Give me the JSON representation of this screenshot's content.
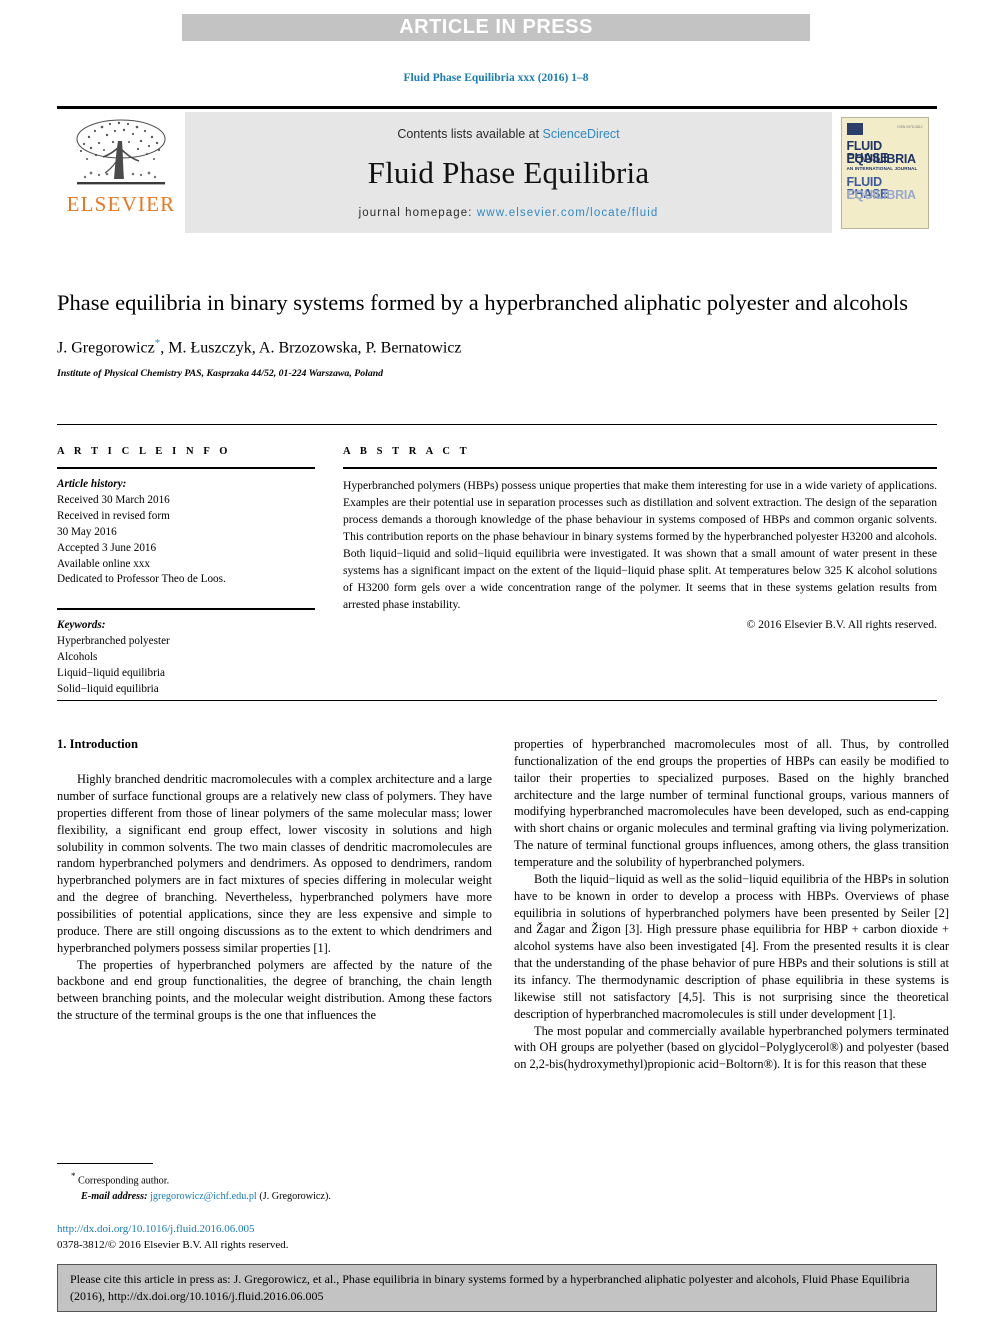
{
  "banner": {
    "text": "ARTICLE IN PRESS"
  },
  "running_head": "Fluid Phase Equilibria xxx (2016) 1–8",
  "masthead": {
    "contents_prefix": "Contents lists available at ",
    "sciencedirect": "ScienceDirect",
    "journal_name": "Fluid Phase Equilibria",
    "homepage_prefix": "journal homepage: ",
    "homepage_url": "www.elsevier.com/locate/fluid",
    "publisher": "ELSEVIER",
    "cover": {
      "line1": "FLUID PHASE",
      "line2": "EQUILIBRIA",
      "subtitle": "AN INTERNATIONAL JOURNAL",
      "line3": "FLUID PHASE",
      "line4": "EQUILIBRIA",
      "corner_note": "ISSN 0378-3812"
    }
  },
  "article": {
    "title": "Phase equilibria in binary systems formed by a hyperbranched aliphatic polyester and alcohols",
    "authors": "J. Gregorowicz",
    "authors_rest": ", M. Łuszczyk, A. Brzozowska, P. Bernatowicz",
    "corresponding_marker": "*",
    "affiliation": "Institute of Physical Chemistry PAS, Kasprzaka 44/52, 01-224 Warszawa, Poland"
  },
  "info": {
    "heading": "A R T I C L E   I N F O",
    "history_label": "Article history:",
    "history": [
      "Received 30 March 2016",
      "Received in revised form",
      "30 May 2016",
      "Accepted 3 June 2016",
      "Available online xxx",
      "Dedicated to Professor Theo de Loos."
    ],
    "keywords_label": "Keywords:",
    "keywords": [
      "Hyperbranched polyester",
      "Alcohols",
      "Liquid−liquid equilibria",
      "Solid−liquid equilibria"
    ]
  },
  "abstract": {
    "heading": "A B S T R A C T",
    "text": "Hyperbranched polymers (HBPs) possess unique properties that make them interesting for use in a wide variety of applications. Examples are their potential use in separation processes such as distillation and solvent extraction. The design of the separation process demands a thorough knowledge of the phase behaviour in systems composed of HBPs and common organic solvents. This contribution reports on the phase behaviour in binary systems formed by the hyperbranched polyester H3200 and alcohols. Both liquid−liquid and solid−liquid equilibria were investigated. It was shown that a small amount of water present in these systems has a significant impact on the extent of the liquid−liquid phase split. At temperatures below 325 K alcohol solutions of H3200 form gels over a wide concentration range of the polymer. It seems that in these systems gelation results from arrested phase instability.",
    "copyright": "© 2016 Elsevier B.V. All rights reserved."
  },
  "body": {
    "section_heading": "1. Introduction",
    "left_paragraphs": [
      "Highly branched dendritic macromolecules with a complex architecture and a large number of surface functional groups are a relatively new class of polymers. They have properties different from those of linear polymers of the same molecular mass; lower flexibility, a significant end group effect, lower viscosity in solutions and high solubility in common solvents. The two main classes of dendritic macromolecules are random hyperbranched polymers and dendrimers. As opposed to dendrimers, random hyperbranched polymers are in fact mixtures of species differing in molecular weight and the degree of branching. Nevertheless, hyperbranched polymers have more possibilities of potential applications, since they are less expensive and simple to produce. There are still ongoing discussions as to the extent to which dendrimers and hyperbranched polymers possess similar properties [1].",
      "The properties of hyperbranched polymers are affected by the nature of the backbone and end group functionalities, the degree of branching, the chain length between branching points, and the molecular weight distribution. Among these factors the structure of the terminal groups is the one that influences the"
    ],
    "right_paragraphs": [
      "properties of hyperbranched macromolecules most of all. Thus, by controlled functionalization of the end groups the properties of HBPs can easily be modified to tailor their properties to specialized purposes. Based on the highly branched architecture and the large number of terminal functional groups, various manners of modifying hyperbranched macromolecules have been developed, such as end-capping with short chains or organic molecules and terminal grafting via living polymerization. The nature of terminal functional groups influences, among others, the glass transition temperature and the solubility of hyperbranched polymers.",
      "Both the liquid−liquid as well as the solid−liquid equilibria of the HBPs in solution have to be known in order to develop a process with HBPs. Overviews of phase equilibria in solutions of hyperbranched polymers have been presented by Seiler [2] and Žagar and Žigon [3]. High pressure phase equilibria for HBP + carbon dioxide + alcohol systems have also been investigated [4]. From the presented results it is clear that the understanding of the phase behavior of pure HBPs and their solutions is still at its infancy. The thermodynamic description of phase equilibria in these systems is likewise still not satisfactory [4,5]. This is not surprising since the theoretical description of hyperbranched macromolecules is still under development [1].",
      "The most popular and commercially available hyperbranched polymers terminated with OH groups are polyether (based on glycidol−Polyglycerol®) and polyester (based on 2,2-bis(hydroxymethyl)propionic acid−Boltorn®). It is for this reason that these"
    ],
    "references_inline": [
      "[1]",
      "[2]",
      "[3]",
      "[4]",
      "[4,5]"
    ]
  },
  "footer": {
    "corresponding_marker": "*",
    "corresponding_label": "Corresponding author.",
    "email_label": "E-mail address:",
    "email": "jgregorowicz@ichf.edu.pl",
    "email_owner": "(J. Gregorowicz).",
    "doi_url": "http://dx.doi.org/10.1016/j.fluid.2016.06.005",
    "issn_line": "0378-3812/© 2016 Elsevier B.V. All rights reserved."
  },
  "cite_box": {
    "text": "Please cite this article in press as: J. Gregorowicz, et al., Phase equilibria in binary systems formed by a hyperbranched aliphatic polyester and alcohols, Fluid Phase Equilibria (2016), http://dx.doi.org/10.1016/j.fluid.2016.06.005"
  }
}
